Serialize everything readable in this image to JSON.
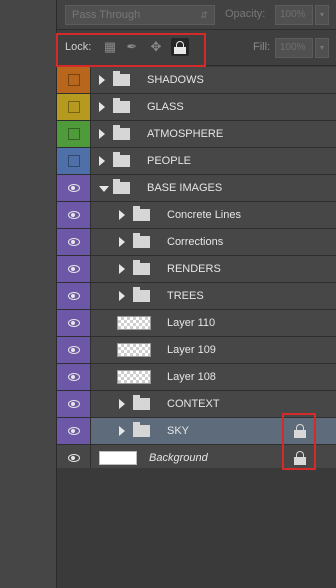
{
  "top": {
    "blend_mode": "Pass Through",
    "opacity_label": "Opacity:",
    "opacity_value": "100%"
  },
  "lock": {
    "label": "Lock:",
    "icons": [
      "lock-transparent-pixels-icon",
      "lock-image-pixels-icon",
      "lock-position-icon",
      "lock-all-icon"
    ],
    "fill_label": "Fill:",
    "fill_value": "100%"
  },
  "colors": {
    "red_highlight": "#d42a2a",
    "orange": "#b8661b",
    "yellow": "#b59a1f",
    "green": "#4f9a3a",
    "blue": "#4e6fa8",
    "purple": "#6c58a6",
    "selected_row": "#5e6b7a"
  },
  "layers": [
    {
      "name": "SHADOWS",
      "kind": "group",
      "vis_color": "#b8661b",
      "visible": false,
      "expanded": false,
      "indent": 0
    },
    {
      "name": "GLASS",
      "kind": "group",
      "vis_color": "#b59a1f",
      "visible": false,
      "expanded": false,
      "indent": 0
    },
    {
      "name": "ATMOSPHERE",
      "kind": "group",
      "vis_color": "#4f9a3a",
      "visible": false,
      "expanded": false,
      "indent": 0
    },
    {
      "name": "PEOPLE",
      "kind": "group",
      "vis_color": "#4e6fa8",
      "visible": false,
      "expanded": false,
      "indent": 0
    },
    {
      "name": "BASE IMAGES",
      "kind": "group",
      "vis_color": "#6c58a6",
      "visible": true,
      "expanded": true,
      "indent": 0
    },
    {
      "name": "Concrete Lines",
      "kind": "group",
      "vis_color": "#6c58a6",
      "visible": true,
      "expanded": false,
      "indent": 1
    },
    {
      "name": "Corrections",
      "kind": "group",
      "vis_color": "#6c58a6",
      "visible": true,
      "expanded": false,
      "indent": 1
    },
    {
      "name": "RENDERS",
      "kind": "group",
      "vis_color": "#6c58a6",
      "visible": true,
      "expanded": false,
      "indent": 1
    },
    {
      "name": "TREES",
      "kind": "group",
      "vis_color": "#6c58a6",
      "visible": true,
      "expanded": false,
      "indent": 1
    },
    {
      "name": "Layer 110",
      "kind": "layer",
      "vis_color": "#6c58a6",
      "visible": true,
      "indent": 1
    },
    {
      "name": "Layer 109",
      "kind": "layer",
      "vis_color": "#6c58a6",
      "visible": true,
      "indent": 1
    },
    {
      "name": "Layer 108",
      "kind": "layer",
      "vis_color": "#6c58a6",
      "visible": true,
      "indent": 1
    },
    {
      "name": "CONTEXT",
      "kind": "group",
      "vis_color": "#6c58a6",
      "visible": true,
      "expanded": false,
      "indent": 1
    },
    {
      "name": "SKY",
      "kind": "group",
      "vis_color": "#6c58a6",
      "visible": true,
      "expanded": false,
      "indent": 1,
      "selected": true,
      "locked": true
    },
    {
      "name": "Background",
      "kind": "background",
      "vis_color": "#474747",
      "visible": true,
      "indent": 0,
      "locked": true,
      "italic": true
    }
  ]
}
